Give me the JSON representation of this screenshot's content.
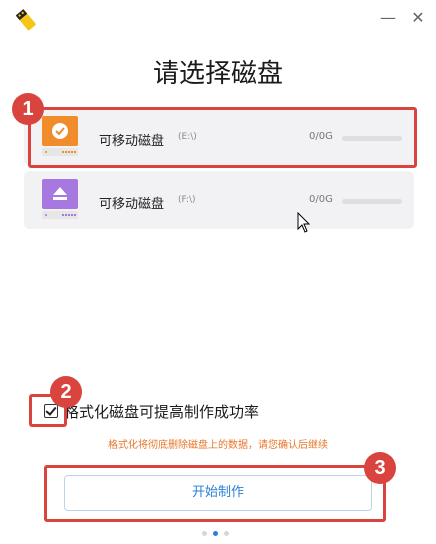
{
  "window": {
    "minimize_glyph": "—",
    "close_glyph": "✕"
  },
  "page_title": "请选择磁盘",
  "disks": [
    {
      "name": "可移动磁盘",
      "drive": "(E:\\)",
      "capacity": "0/0G",
      "icon": "usb-drive-checked-icon",
      "color": "#f08c2a",
      "usage": 0
    },
    {
      "name": "可移动磁盘",
      "drive": "(F:\\)",
      "capacity": "0/0G",
      "icon": "usb-drive-eject-icon",
      "color": "#a678e0",
      "usage": 0
    }
  ],
  "format_option": {
    "label": "格式化磁盘可提高制作成功率",
    "checked": true
  },
  "warning": "格式化将彻底删除磁盘上的数据，请您确认后继续",
  "start_button": "开始制作",
  "pagination": {
    "total": 3,
    "active": 1
  },
  "annotations": [
    "1",
    "2",
    "3"
  ],
  "colors": {
    "accent": "#2b7fd8",
    "annotation": "#d9443f",
    "warning": "#e8762a"
  }
}
